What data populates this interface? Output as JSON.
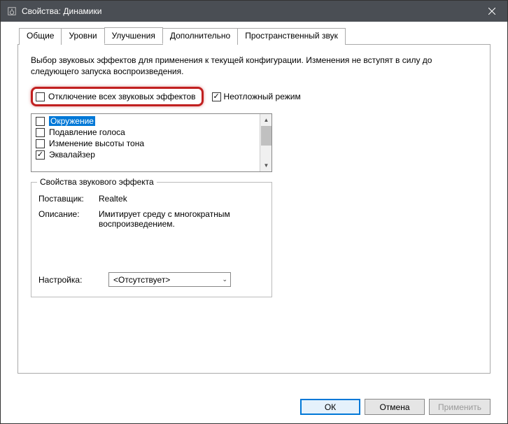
{
  "window": {
    "title": "Свойства: Динамики"
  },
  "tabs": {
    "general": "Общие",
    "levels": "Уровни",
    "enhancements": "Улучшения",
    "advanced": "Дополнительно",
    "spatial": "Пространственный звук"
  },
  "panel": {
    "description": "Выбор звуковых эффектов для применения к текущей конфигурации. Изменения не вступят в силу до следующего запуска воспроизведения.",
    "disable_all_label": "Отключение всех звуковых эффектов",
    "immediate_label": "Неотложный режим",
    "effects": [
      {
        "label": "Окружение",
        "checked": false,
        "selected": true
      },
      {
        "label": "Подавление голоса",
        "checked": false,
        "selected": false
      },
      {
        "label": "Изменение высоты тона",
        "checked": false,
        "selected": false
      },
      {
        "label": "Эквалайзер",
        "checked": true,
        "selected": false
      }
    ],
    "group_title": "Свойства звукового эффекта",
    "provider_label": "Поставщик:",
    "provider_value": "Realtek",
    "desc_label": "Описание:",
    "desc_value": "Имитирует среду с многократным воспроизведением.",
    "setting_label": "Настройка:",
    "setting_value": "<Отсутствует>"
  },
  "buttons": {
    "ok": "ОК",
    "cancel": "Отмена",
    "apply": "Применить"
  }
}
